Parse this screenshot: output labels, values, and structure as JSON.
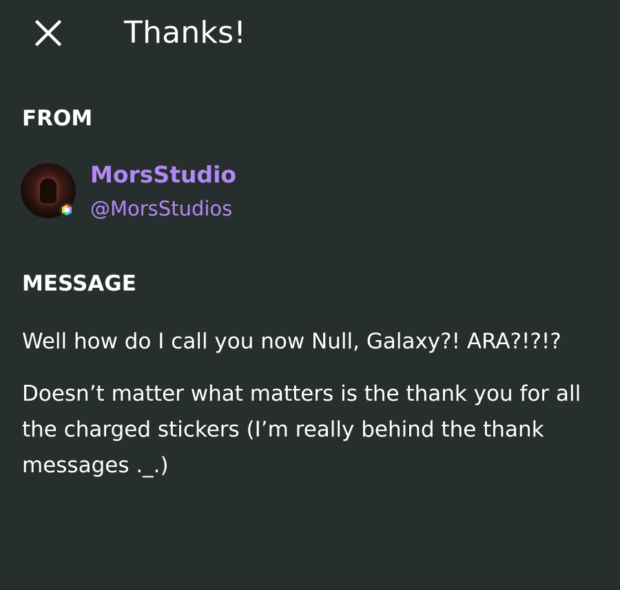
{
  "header": {
    "title": "Thanks!",
    "close_icon": "close-icon"
  },
  "from": {
    "label": "FROM",
    "sender": {
      "display_name": "MorsStudio",
      "handle": "@MorsStudios",
      "avatar": "avatar-image",
      "badge_icon": "hexagon-badge-icon"
    }
  },
  "message": {
    "label": "MESSAGE",
    "paragraphs": [
      "Well how do I call you now Null, Galaxy?! ARA?!?!?",
      "Doesn’t matter what matters is the thank you for all the charged stickers (I’m really behind the thank messages ._.)"
    ]
  },
  "colors": {
    "background": "#272e2e",
    "text": "#ffffff",
    "accent": "#b388f2"
  }
}
